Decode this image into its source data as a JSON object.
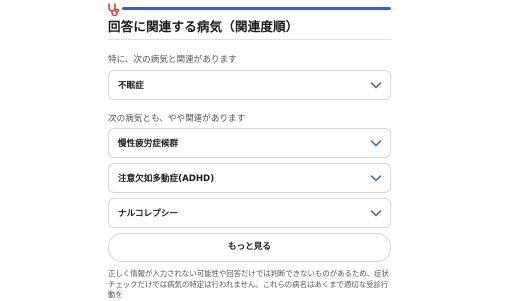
{
  "header": {
    "title": "回答に関連する病気（関連度順）",
    "progress_fraction": 1.0
  },
  "theme": {
    "accent": "#3b5bdb",
    "icon_color": "#e03131"
  },
  "sections": [
    {
      "label": "特に、次の病気と関連があります",
      "items": [
        {
          "label": "不眠症"
        }
      ]
    },
    {
      "label": "次の病気とも、やや関連があります",
      "items": [
        {
          "label": "慢性疲労症候群"
        },
        {
          "label": "注意欠如多動症(ADHD)"
        },
        {
          "label": "ナルコレプシー"
        }
      ]
    }
  ],
  "more_button_label": "もっと見る",
  "notice": "正しく情報が入力されない可能性や回答だけでは判断できないものがあるため、症状チェックだけでは病気の特定は行われません。これらの病名はあくまで適切な受診行動を"
}
